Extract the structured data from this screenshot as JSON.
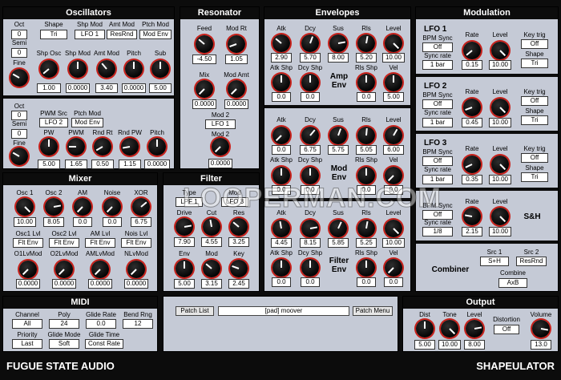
{
  "oscillators": {
    "title": "Oscillators",
    "osc1": {
      "oct_label": "Oct",
      "oct_val": "0",
      "semi_label": "Semi",
      "semi_val": "0",
      "fine_label": "Fine",
      "shape_label": "Shape",
      "shape_val": "Tri",
      "shp_mod_label": "Shp Mod",
      "shp_mod_val": "LFO 1",
      "amt_mod_label": "Amt Mod",
      "amt_mod_val": "ResRnd",
      "ptch_mod_label": "Ptch Mod",
      "ptch_mod_val": "Mod Env",
      "shp_osc_label": "Shp Osc",
      "shp_osc_val": "1.00",
      "shp_mod_knob_label": "Shp Mod",
      "shp_mod_knob_val": "0.0000",
      "amt_mod_knob_label": "Amt Mod",
      "amt_mod_knob_val": "3.40",
      "pitch_label": "Pitch",
      "pitch_val": "0.0000",
      "sub_label": "Sub",
      "sub_val": "5.00"
    },
    "osc2": {
      "oct_label": "Oct",
      "oct_val": "0",
      "semi_label": "Semi",
      "semi_val": "0",
      "fine_label": "Fine",
      "pwm_src_label": "PWM Src",
      "pwm_src_val": "LFO 2",
      "ptch_mod_label": "Ptch Mod",
      "ptch_mod_val": "Mod Env",
      "pw_label": "PW",
      "pw_val": "5.00",
      "pwm_label": "PWM",
      "pwm_val": "1.65",
      "rnd_rt_label": "Rnd Rt",
      "rnd_rt_val": "0.50",
      "rnd_pw_label": "Rnd PW",
      "rnd_pw_val": "1.15",
      "pitch_label": "Pitch",
      "pitch_val": "0.0000"
    }
  },
  "resonator": {
    "title": "Resonator",
    "feed_label": "Feed",
    "feed_val": "-4.50",
    "mod_rt_label": "Mod Rt",
    "mod_rt_val": "1.05",
    "mix_label": "Mix",
    "mix_val": "0.0000",
    "mod_amt_label": "Mod Amt",
    "mod_amt_val": "0.0000",
    "mod2_label": "Mod 2",
    "mod2_val": "LFO 1",
    "mod2_knob_label": "Mod 2",
    "mod2_knob_val": "0.0000"
  },
  "envelopes": {
    "title": "Envelopes",
    "amp": {
      "name_line1": "Amp",
      "name_line2": "Env",
      "atk_label": "Atk",
      "atk_val": "2.90",
      "dcy_label": "Dcy",
      "dcy_val": "5.70",
      "sus_label": "Sus",
      "sus_val": "8.00",
      "rls_label": "Rls",
      "rls_val": "5.20",
      "level_label": "Level",
      "level_val": "10.00",
      "atk_shp_label": "Atk Shp",
      "atk_shp_val": "0.0",
      "dcy_shp_label": "Dcy Shp",
      "dcy_shp_val": "0.0",
      "rls_shp_label": "Rls Shp",
      "rls_shp_val": "0.0",
      "vel_label": "Vel",
      "vel_val": "5.00"
    },
    "mod": {
      "name_line1": "Mod",
      "name_line2": "Env",
      "atk_label": "Atk",
      "atk_val": "0.0",
      "dcy_label": "Dcy",
      "dcy_val": "6.75",
      "sus_label": "Sus",
      "sus_val": "5.75",
      "rls_label": "Rls",
      "rls_val": "5.05",
      "level_label": "Level",
      "level_val": "6.00",
      "atk_shp_label": "Atk Shp",
      "atk_shp_val": "0.0",
      "dcy_shp_label": "Dcy Shp",
      "dcy_shp_val": "0.0",
      "rls_shp_label": "Rls Shp",
      "rls_shp_val": "0.0",
      "vel_label": "Vel",
      "vel_val": "0.0"
    },
    "filter": {
      "name_line1": "Filter",
      "name_line2": "Env",
      "atk_label": "Atk",
      "atk_val": "4.45",
      "dcy_label": "Dcy",
      "dcy_val": "8.15",
      "sus_label": "Sus",
      "sus_val": "5.85",
      "rls_label": "Rls",
      "rls_val": "5.25",
      "level_label": "Level",
      "level_val": "10.00",
      "atk_shp_label": "Atk Shp",
      "atk_shp_val": "0.0",
      "dcy_shp_label": "Dcy Shp",
      "dcy_shp_val": "0.0",
      "rls_shp_label": "Rls Shp",
      "rls_shp_val": "0.0",
      "vel_label": "Vel",
      "vel_val": "0.0"
    }
  },
  "modulation": {
    "title": "Modulation",
    "lfo1": {
      "name": "LFO 1",
      "bpm_label": "BPM Sync",
      "bpm_val": "Off",
      "sync_label": "Sync rate",
      "sync_val": "1 bar",
      "rate_label": "Rate",
      "rate_val": "0.15",
      "level_label": "Level",
      "level_val": "10.00",
      "keytrig_label": "Key trig",
      "keytrig_val": "Off",
      "shape_label": "Shape",
      "shape_val": "Tri"
    },
    "lfo2": {
      "name": "LFO 2",
      "bpm_label": "BPM Sync",
      "bpm_val": "Off",
      "sync_label": "Sync rate",
      "sync_val": "1 bar",
      "rate_label": "Rate",
      "rate_val": "0.45",
      "level_label": "Level",
      "level_val": "10.00",
      "keytrig_label": "Key trig",
      "keytrig_val": "Off",
      "shape_label": "Shape",
      "shape_val": "Tri"
    },
    "lfo3": {
      "name": "LFO 3",
      "bpm_label": "BPM Sync",
      "bpm_val": "Off",
      "sync_label": "Sync rate",
      "sync_val": "1 bar",
      "rate_label": "Rate",
      "rate_val": "0.35",
      "level_label": "Level",
      "level_val": "10.00",
      "keytrig_label": "Key trig",
      "keytrig_val": "Off",
      "shape_label": "Shape",
      "shape_val": "Tri"
    },
    "sh": {
      "name": "S&H",
      "bpm_label": "BPM Sync",
      "bpm_val": "Off",
      "sync_label": "Sync rate",
      "sync_val": "1/8",
      "rate_label": "Rate",
      "rate_val": "2.15",
      "level_label": "Level",
      "level_val": "10.00"
    },
    "combiner": {
      "name": "Combiner",
      "src1_label": "Src 1",
      "src1_val": "S+H",
      "src2_label": "Src 2",
      "src2_val": "ResRnd",
      "combine_label": "Combine",
      "combine_val": "AxB"
    }
  },
  "mixer": {
    "title": "Mixer",
    "osc1_label": "Osc 1",
    "osc1_val": "10.00",
    "osc2_label": "Osc 2",
    "osc2_val": "8.05",
    "am_label": "AM",
    "am_val": "0.0",
    "noise_label": "Noise",
    "noise_val": "0.0",
    "xor_label": "XOR",
    "xor_val": "6.75",
    "osc1lvl_label": "Osc1 Lvl",
    "osc1lvl_val": "Flt Env",
    "osc2lvl_label": "Osc2 Lvl",
    "osc2lvl_val": "Flt Env",
    "amlvl_label": "AM Lvl",
    "amlvl_val": "Flt Env",
    "noislvl_label": "Nois Lvl",
    "noislvl_val": "Flt Env",
    "o1lvmod_label": "O1LvMod",
    "o1lvmod_val": "0.0000",
    "o2lvmod_label": "O2LvMod",
    "o2lvmod_val": "0.0000",
    "amlvmod_label": "AMLvMod",
    "amlvmod_val": "0.0000",
    "nlvmod_label": "NLvMod",
    "nlvmod_val": "0.0000"
  },
  "filter": {
    "title": "Filter",
    "type_label": "Type",
    "type_val": "LPF 1",
    "mod_label": "Mod",
    "mod_val": "LFO 3",
    "drive_label": "Drive",
    "drive_val": "7.90",
    "cut_label": "Cut",
    "cut_val": "4.55",
    "res_label": "Res",
    "res_val": "3.25",
    "env_label": "Env",
    "env_val": "5.00",
    "modk_label": "Mod",
    "modk_val": "3.15",
    "key_label": "Key",
    "key_val": "2.45"
  },
  "midi": {
    "title": "MIDI",
    "channel_label": "Channel",
    "channel_val": "All",
    "poly_label": "Poly",
    "poly_val": "24",
    "glide_rate_label": "Glide Rate",
    "glide_rate_val": "0.0",
    "bend_rng_label": "Bend Rng",
    "bend_rng_val": "12",
    "priority_label": "Priority",
    "priority_val": "Last",
    "glide_mode_label": "Glide Mode",
    "glide_mode_val": "Soft",
    "glide_time_label": "Glide Time",
    "glide_time_val": "Const Rate"
  },
  "patch": {
    "list_button": "Patch List",
    "name": "[pad] moover",
    "menu_button": "Patch Menu"
  },
  "output": {
    "title": "Output",
    "dist_label": "Dist",
    "dist_val": "5.00",
    "tone_label": "Tone",
    "tone_val": "10.00",
    "level_label": "Level",
    "level_val": "8.00",
    "distortion_label": "Distortion",
    "distortion_val": "Off",
    "volume_label": "Volume",
    "volume_val": "13.0"
  },
  "footer": {
    "brand": "FUGUE STATE AUDIO",
    "product": "SHAPEULATOR"
  },
  "watermark": "LOOPERMAN.COM",
  "colors": {
    "background": "#0c0c0c",
    "panel": "#c5cad6",
    "knob_ring": "#c8201a"
  }
}
